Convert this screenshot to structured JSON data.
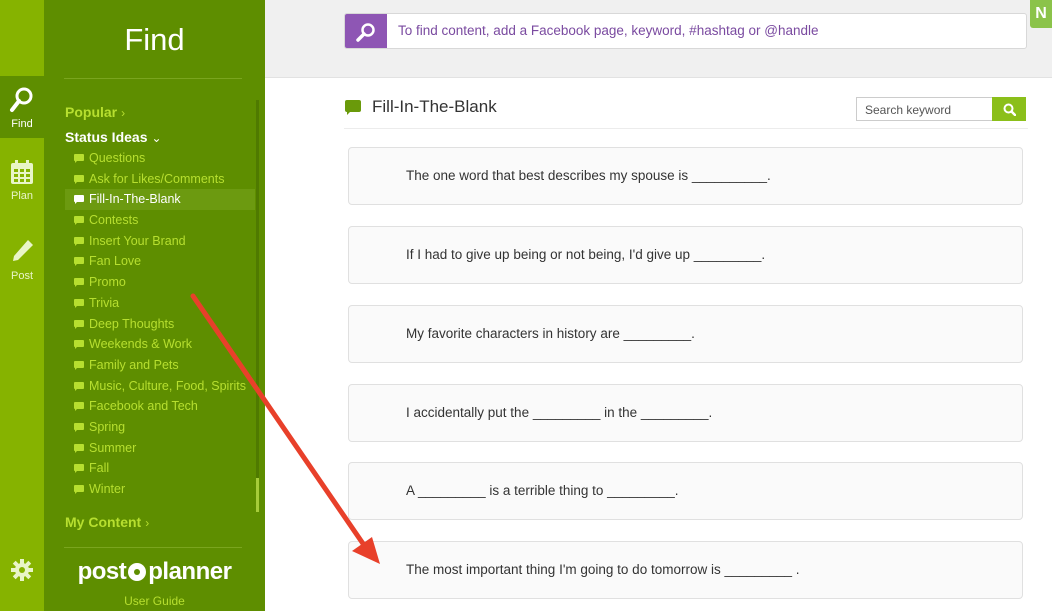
{
  "rail": {
    "items": [
      {
        "label": "Find",
        "icon": "search-icon"
      },
      {
        "label": "Plan",
        "icon": "calendar-icon"
      },
      {
        "label": "Post",
        "icon": "pencil-icon"
      }
    ],
    "settings_icon": "gear-icon"
  },
  "sidebar": {
    "title": "Find",
    "popular": "Popular",
    "status_ideas": "Status Ideas",
    "items": [
      "Questions",
      "Ask for Likes/Comments",
      "Fill-In-The-Blank",
      "Contests",
      "Insert Your Brand",
      "Fan Love",
      "Promo",
      "Trivia",
      "Deep Thoughts",
      "Weekends & Work",
      "Family and Pets",
      "Music, Culture, Food, Spirits",
      "Facebook and Tech",
      "Spring",
      "Summer",
      "Fall",
      "Winter"
    ],
    "active_item": "Fill-In-The-Blank",
    "my_content": "My Content",
    "logo_left": "post",
    "logo_right": "planner",
    "user_guide": "User Guide"
  },
  "topbar": {
    "search_placeholder": "To find content, add a Facebook page, keyword, #hashtag or @handle",
    "corner_label": "N"
  },
  "main": {
    "title": "Fill-In-The-Blank",
    "keyword_placeholder": "Search keyword",
    "cards": [
      "The one word that best describes my spouse is __________.",
      "If I had to give up being or not being, I'd give up _________.",
      "My favorite characters in history are _________.",
      "I accidentally put the _________ in the _________.",
      "A _________ is a terrible thing to _________.",
      "The most important thing I'm going to do tomorrow is _________ ."
    ]
  },
  "colors": {
    "rail": "#86b300",
    "sidebar": "#5e8e00",
    "link": "#b7df2f",
    "search_button": "#8e56b4",
    "keyword_button": "#8bbf1a",
    "annotation_arrow": "#e8402a"
  }
}
